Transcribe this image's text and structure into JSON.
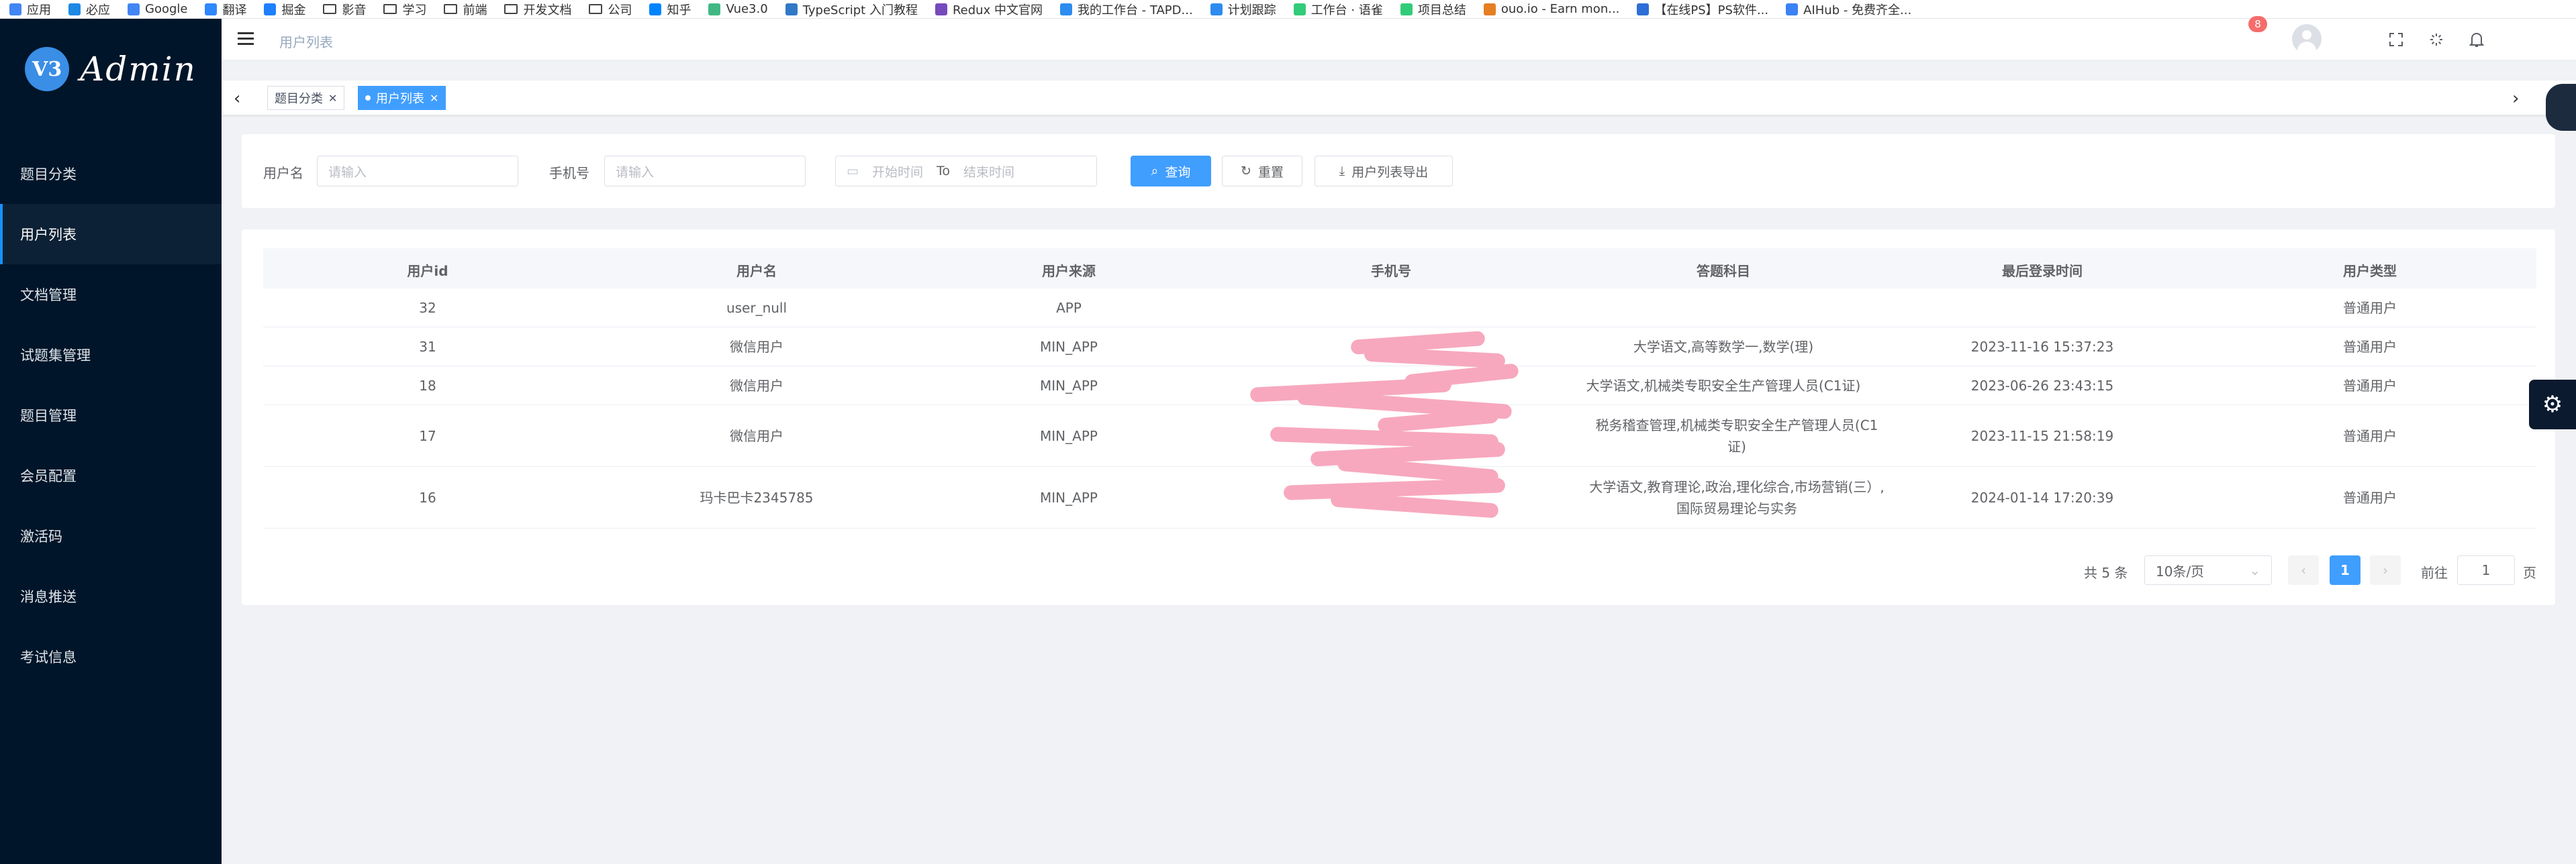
{
  "bookmarks": [
    {
      "label": "应用",
      "icon": "apps-grid-icon"
    },
    {
      "label": "必应",
      "icon": "bing-icon"
    },
    {
      "label": "Google",
      "icon": "google-icon"
    },
    {
      "label": "翻译",
      "icon": "translate-icon"
    },
    {
      "label": "掘金",
      "icon": "juejin-icon"
    },
    {
      "label": "影音",
      "icon": "folder-icon"
    },
    {
      "label": "学习",
      "icon": "folder-icon"
    },
    {
      "label": "前端",
      "icon": "folder-icon"
    },
    {
      "label": "开发文档",
      "icon": "folder-icon"
    },
    {
      "label": "公司",
      "icon": "folder-icon"
    },
    {
      "label": "知乎",
      "icon": "zhihu-icon"
    },
    {
      "label": "Vue3.0",
      "icon": "vue-icon"
    },
    {
      "label": "TypeScript 入门教程",
      "icon": "typescript-icon"
    },
    {
      "label": "Redux 中文官网",
      "icon": "redux-icon"
    },
    {
      "label": "我的工作台 - TAPD...",
      "icon": "tapd-icon"
    },
    {
      "label": "计划跟踪",
      "icon": "tracking-icon"
    },
    {
      "label": "工作台 · 语雀",
      "icon": "yuque-icon"
    },
    {
      "label": "项目总结",
      "icon": "yuque-icon"
    },
    {
      "label": "ouo.io - Earn mon...",
      "icon": "ouo-icon"
    },
    {
      "label": "【在线PS】PS软件...",
      "icon": "ps-icon"
    },
    {
      "label": "AIHub - 免费齐全...",
      "icon": "aihub-icon"
    }
  ],
  "app": {
    "logo_mark": "V3",
    "logo_text": "Admin"
  },
  "sidebar": {
    "items": [
      {
        "label": "题目分类",
        "active": false
      },
      {
        "label": "用户列表",
        "active": true
      },
      {
        "label": "文档管理",
        "active": false
      },
      {
        "label": "试题集管理",
        "active": false
      },
      {
        "label": "题目管理",
        "active": false
      },
      {
        "label": "会员配置",
        "active": false
      },
      {
        "label": "激活码",
        "active": false
      },
      {
        "label": "消息推送",
        "active": false
      },
      {
        "label": "考试信息",
        "active": false
      }
    ]
  },
  "header": {
    "breadcrumb": "用户列表",
    "notification_count": "8",
    "icons": [
      "fullscreen-icon",
      "theme-icon",
      "bell-icon",
      "avatar-icon"
    ]
  },
  "tags": [
    {
      "label": "题目分类",
      "active": false
    },
    {
      "label": "用户列表",
      "active": true
    }
  ],
  "filters": {
    "username_label": "用户名",
    "username_placeholder": "请输入",
    "phone_label": "手机号",
    "phone_placeholder": "请输入",
    "start_placeholder": "开始时间",
    "range_separator": "To",
    "end_placeholder": "结束时间",
    "search_button": "查询",
    "reset_button": "重置",
    "export_button": "用户列表导出"
  },
  "table": {
    "columns": [
      "用户id",
      "用户名",
      "用户来源",
      "手机号",
      "答题科目",
      "最后登录时间",
      "用户类型"
    ],
    "rows": [
      {
        "id": "32",
        "name": "user_null",
        "source": "APP",
        "phone": "",
        "subjects": "",
        "last_login": "",
        "type": "普通用户"
      },
      {
        "id": "31",
        "name": "微信用户",
        "source": "MIN_APP",
        "phone": "",
        "subjects": "大学语文,高等数学一,数学(理)",
        "last_login": "2023-11-16 15:37:23",
        "type": "普通用户"
      },
      {
        "id": "18",
        "name": "微信用户",
        "source": "MIN_APP",
        "phone": "",
        "subjects": "大学语文,机械类专职安全生产管理人员(C1证)",
        "last_login": "2023-06-26 23:43:15",
        "type": "普通用户"
      },
      {
        "id": "17",
        "name": "微信用户",
        "source": "MIN_APP",
        "phone": "",
        "subjects": "税务稽查管理,机械类专职安全生产管理人员(C1证)",
        "last_login": "2023-11-15 21:58:19",
        "type": "普通用户"
      },
      {
        "id": "16",
        "name": "玛卡巴卡2345785",
        "source": "MIN_APP",
        "phone": "",
        "subjects": "大学语文,教育理论,政治,理化综合,市场营销(三）,国际贸易理论与实务",
        "last_login": "2024-01-14 17:20:39",
        "type": "普通用户"
      }
    ]
  },
  "pagination": {
    "total_text": "共 5 条",
    "page_size": "10条/页",
    "current_page": "1",
    "goto_label": "前往",
    "goto_value": "1",
    "page_suffix": "页"
  },
  "colors": {
    "primary": "#409eff",
    "sidebar_bg": "#001529",
    "badge": "#f56c6c",
    "redaction": "#f7a8be"
  }
}
